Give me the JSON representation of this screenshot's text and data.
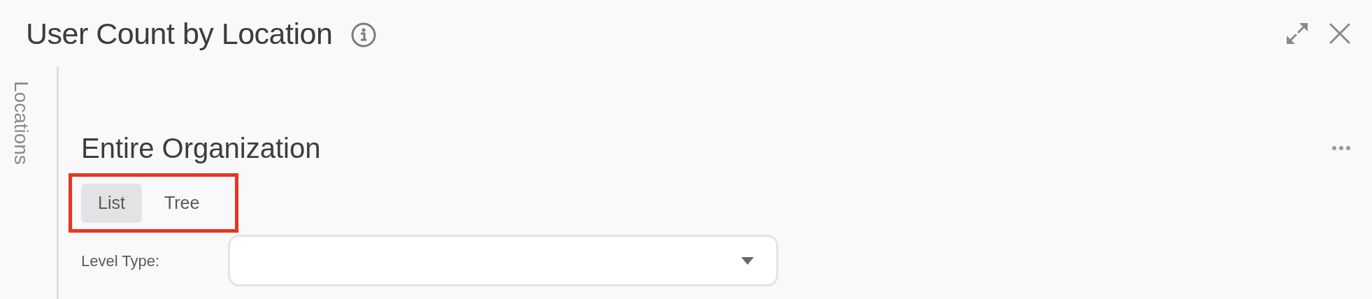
{
  "panel": {
    "title": "User Count by Location"
  },
  "sidebar": {
    "label": "Locations"
  },
  "content": {
    "heading": "Entire Organization",
    "view_toggle": [
      {
        "label": "List",
        "selected": true
      },
      {
        "label": "Tree",
        "selected": false
      }
    ],
    "level_type": {
      "label": "Level Type:"
    }
  }
}
